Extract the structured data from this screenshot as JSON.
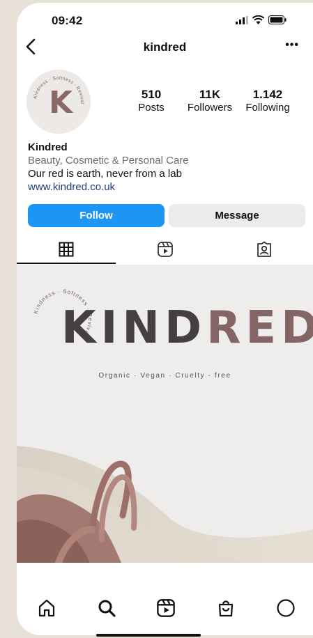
{
  "status_bar": {
    "time": "09:42"
  },
  "header": {
    "username": "kindred"
  },
  "profile": {
    "avatar_letter": "K",
    "avatar_ring_text": "Kindness · Softness · Revival",
    "stats": [
      {
        "value": "510",
        "label": "Posts"
      },
      {
        "value": "11K",
        "label": "Followers"
      },
      {
        "value": "1.142",
        "label": "Following"
      }
    ],
    "name": "Kindred",
    "category": "Beauty, Cosmetic & Personal Care",
    "bio": "Our red is earth, never from a lab",
    "website": "www.kindred.co.uk"
  },
  "actions": {
    "follow_label": "Follow",
    "message_label": "Message"
  },
  "tabs": [
    "grid-icon",
    "reels-icon",
    "tagged-icon"
  ],
  "hero": {
    "ring_text": "Kindness · Softness · Revival",
    "word_dark": "KIND",
    "word_rose": "RED",
    "tagline": "Organic · Vegan · Cruelty - free"
  },
  "bottom_nav": [
    "home-icon",
    "search-icon",
    "reels-icon",
    "shop-icon",
    "profile-icon"
  ],
  "colors": {
    "follow": "#1c96f2",
    "brand_dark": "#444040",
    "brand_rose": "#836565",
    "link": "#1f3e80"
  }
}
